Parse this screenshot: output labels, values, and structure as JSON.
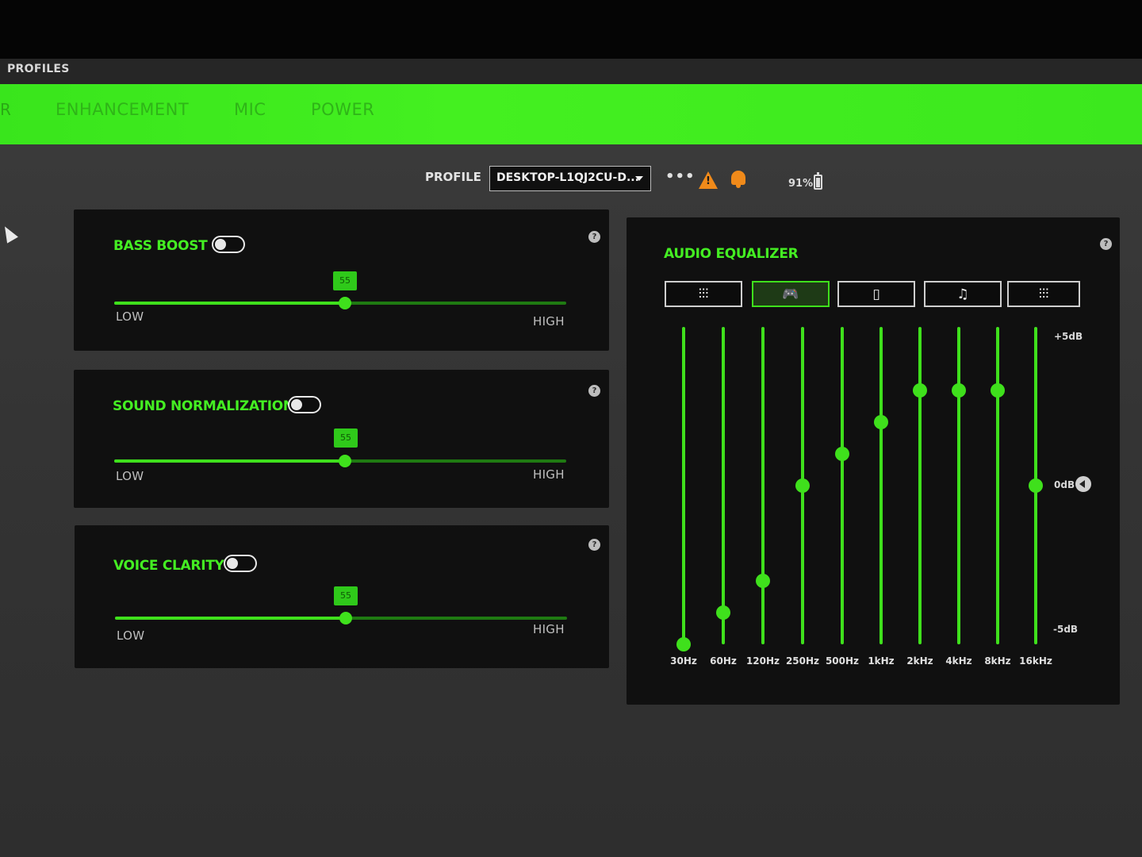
{
  "header": {
    "profiles_label": "PROFILES"
  },
  "tabs": {
    "edge": "R",
    "items": [
      {
        "label": "ENHANCEMENT"
      },
      {
        "label": "MIC"
      },
      {
        "label": "POWER"
      }
    ]
  },
  "profile": {
    "label": "PROFILE",
    "selected": "DESKTOP-L1QJ2CU-D...",
    "more_glyph": "•••",
    "warning_glyph": "!",
    "battery_text": "91%",
    "battery_level": 0.91
  },
  "panels": [
    {
      "title": "BASS BOOST",
      "help": "?",
      "toggle_on": false,
      "value": "55",
      "value_fraction": 0.51,
      "low": "LOW",
      "high": "HIGH"
    },
    {
      "title": "SOUND NORMALIZATION",
      "help": "?",
      "toggle_on": false,
      "value": "55",
      "value_fraction": 0.51,
      "low": "LOW",
      "high": "HIGH"
    },
    {
      "title": "VOICE CLARITY",
      "help": "?",
      "toggle_on": false,
      "value": "55",
      "value_fraction": 0.51,
      "low": "LOW",
      "high": "HIGH"
    }
  ],
  "equalizer": {
    "title": "AUDIO EQUALIZER",
    "help": "?",
    "presets": [
      {
        "icon": "equalizer-sliders-icon",
        "glyph": "⫶⫶⫶",
        "active": false
      },
      {
        "icon": "gamepad-icon",
        "glyph": "🎮",
        "active": true
      },
      {
        "icon": "film-icon",
        "glyph": "▯",
        "active": false
      },
      {
        "icon": "music-note-icon",
        "glyph": "♫",
        "active": false
      },
      {
        "icon": "custom-sliders-icon",
        "glyph": "⫶⫶⫶",
        "active": false
      }
    ],
    "db_max": "+5dB",
    "db_mid": "0dB",
    "db_min": "-5dB",
    "bands": [
      {
        "freq": "30Hz",
        "gain_db": -5.0
      },
      {
        "freq": "60Hz",
        "gain_db": -4.0
      },
      {
        "freq": "120Hz",
        "gain_db": -3.0
      },
      {
        "freq": "250Hz",
        "gain_db": 0.0
      },
      {
        "freq": "500Hz",
        "gain_db": 1.0
      },
      {
        "freq": "1kHz",
        "gain_db": 2.0
      },
      {
        "freq": "2kHz",
        "gain_db": 3.0
      },
      {
        "freq": "4kHz",
        "gain_db": 3.0
      },
      {
        "freq": "8kHz",
        "gain_db": 3.0
      },
      {
        "freq": "16kHz",
        "gain_db": 0.0
      }
    ]
  },
  "colors": {
    "accent": "#3fe01c",
    "warning": "#f08a1a",
    "panel": "#101010"
  }
}
